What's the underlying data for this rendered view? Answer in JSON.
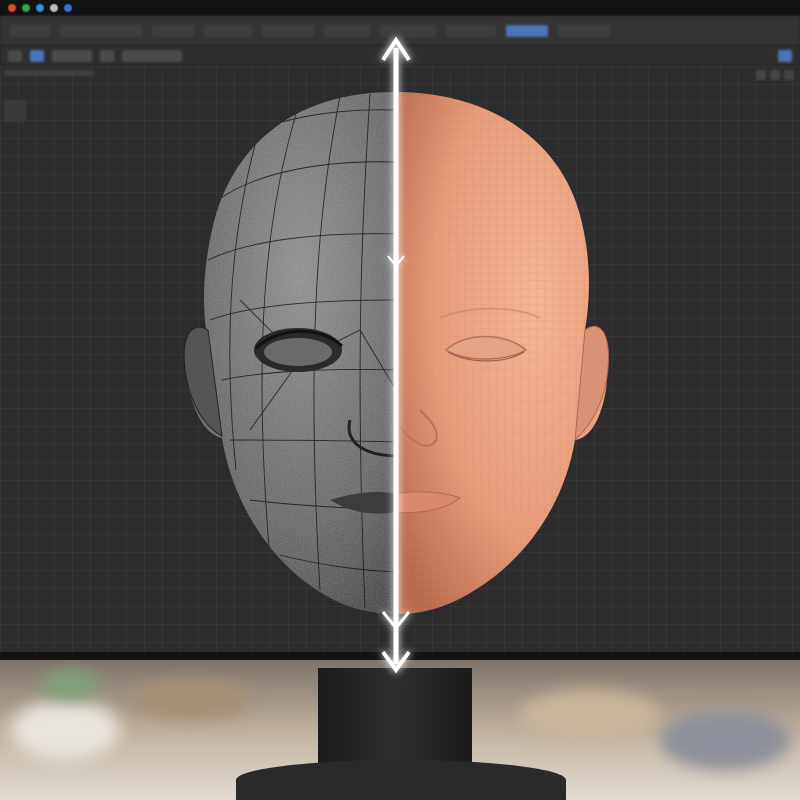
{
  "os_bar": {
    "dots": [
      "#e04a3a",
      "#35a34a",
      "#3f8fe0",
      "#c0c0c0",
      "#3f6fe0"
    ]
  },
  "menu_bar": {
    "items": [
      "",
      "",
      "",
      "",
      "",
      "",
      "",
      "",
      "",
      ""
    ]
  },
  "toolbar": {
    "buttons": [
      "",
      "",
      "",
      "",
      "",
      ""
    ]
  },
  "viewport": {
    "label": "",
    "side_button": ""
  },
  "model": {
    "left_half": "wireframe-textured-grey",
    "right_half": "smooth-skin-subdivided",
    "divider": "double-arrow-slider"
  },
  "colors": {
    "app_bg": "#262626",
    "grid_line": "#353535",
    "skin": "#e8a07c",
    "sculpt": "#6a6a6a",
    "divider_glow": "#ffffff"
  }
}
